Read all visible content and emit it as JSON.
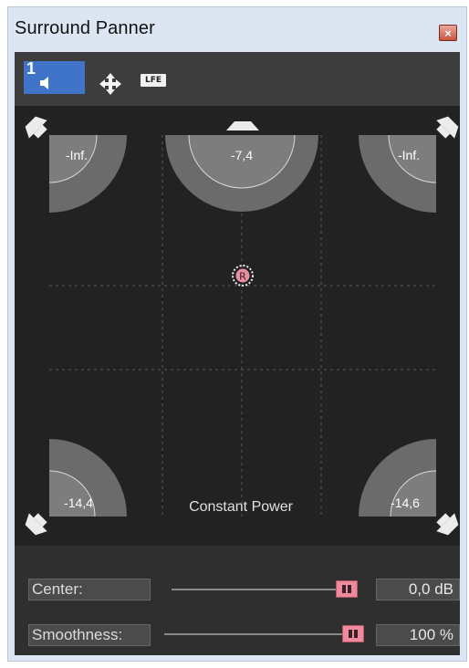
{
  "window": {
    "title": "Surround Panner",
    "close_glyph": "×"
  },
  "toolbar": {
    "speaker_button": {
      "number": "1",
      "icon": "speaker-icon"
    },
    "move_icon": "move-arrows-icon",
    "lfe_label": "LFE"
  },
  "channels": {
    "front_left": "-Inf.",
    "center": "-7,4",
    "front_right": "-Inf.",
    "rear_left": "-14,4",
    "rear_right": "-14,6"
  },
  "pan_marker": {
    "label": "R"
  },
  "pan_mode": "Constant Power",
  "controls": {
    "center": {
      "label": "Center:",
      "value": "0,0 dB",
      "level": 0.92
    },
    "smoothness": {
      "label": "Smoothness:",
      "value": "100 %",
      "level": 1.0
    }
  },
  "colors": {
    "accent_blue": "#3f74c8",
    "slider_thumb": "#ee8a9b",
    "field_bg": "#222222"
  }
}
